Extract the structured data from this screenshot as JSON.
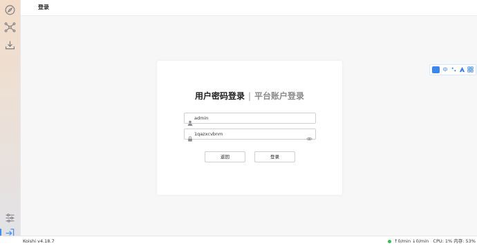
{
  "header": {
    "title": "登录"
  },
  "sidebar": {
    "items": [
      {
        "icon": "compass-icon"
      },
      {
        "icon": "network-icon"
      },
      {
        "icon": "download-icon"
      }
    ],
    "bottom": [
      {
        "icon": "sliders-icon"
      },
      {
        "icon": "login-icon"
      }
    ]
  },
  "login": {
    "tab_active": "用户密码登录",
    "tab_separator": "|",
    "tab_inactive": "平台账户登录",
    "username": {
      "value": "admin"
    },
    "password": {
      "value": "1qazxcvbnm"
    },
    "back_label": "返回",
    "login_label": "登录"
  },
  "floating_toolbar": {
    "items": [
      "中"
    ]
  },
  "status": {
    "version": "Koishi v4.18.7",
    "upload_rate": "0/min",
    "download_rate": "0/min",
    "cpu": "CPU: 1%",
    "memory": "内存: 53%"
  },
  "colors": {
    "accent": "#3f8ef5",
    "online": "#36c04a"
  }
}
